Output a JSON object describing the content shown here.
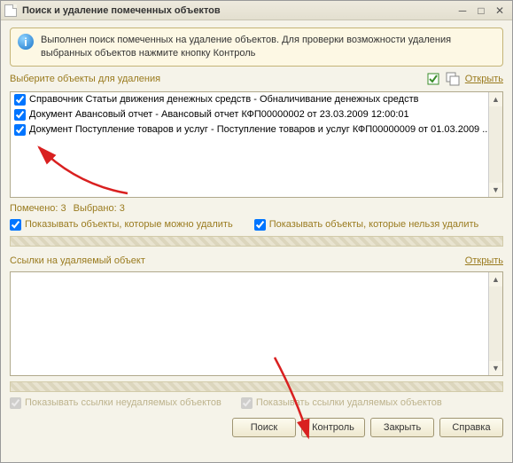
{
  "window": {
    "title": "Поиск и удаление помеченных объектов"
  },
  "info": {
    "text": "Выполнен поиск помеченных на удаление объектов. Для проверки возможности удаления выбранных объектов нажмите кнопку Контроль"
  },
  "top_section": {
    "label": "Выберите объекты для удаления",
    "open_link": "Открыть"
  },
  "list_items": [
    {
      "checked": true,
      "text": "Справочник Статьи движения денежных средств - Обналичивание денежных средств"
    },
    {
      "checked": true,
      "text": "Документ Авансовый отчет - Авансовый отчет КФП00000002 от 23.03.2009 12:00:01"
    },
    {
      "checked": true,
      "text": "Документ Поступление товаров и услуг - Поступление товаров и услуг КФП00000009 от 01.03.2009 ..."
    }
  ],
  "status": {
    "marked": "Помечено: 3",
    "selected": "Выбрано: 3"
  },
  "filters": {
    "can_delete": "Показывать объекты, которые можно удалить",
    "cannot_delete": "Показывать объекты, которые нельзя удалить"
  },
  "refs": {
    "label": "Ссылки на удаляемый объект",
    "open_link": "Открыть"
  },
  "footer_filters": {
    "non_deletable_refs": "Показывать ссылки неудаляемых объектов",
    "deletable_refs": "Показывать ссылки удаляемых объектов"
  },
  "buttons": {
    "search": "Поиск",
    "control": "Контроль",
    "close": "Закрыть",
    "help": "Справка"
  }
}
